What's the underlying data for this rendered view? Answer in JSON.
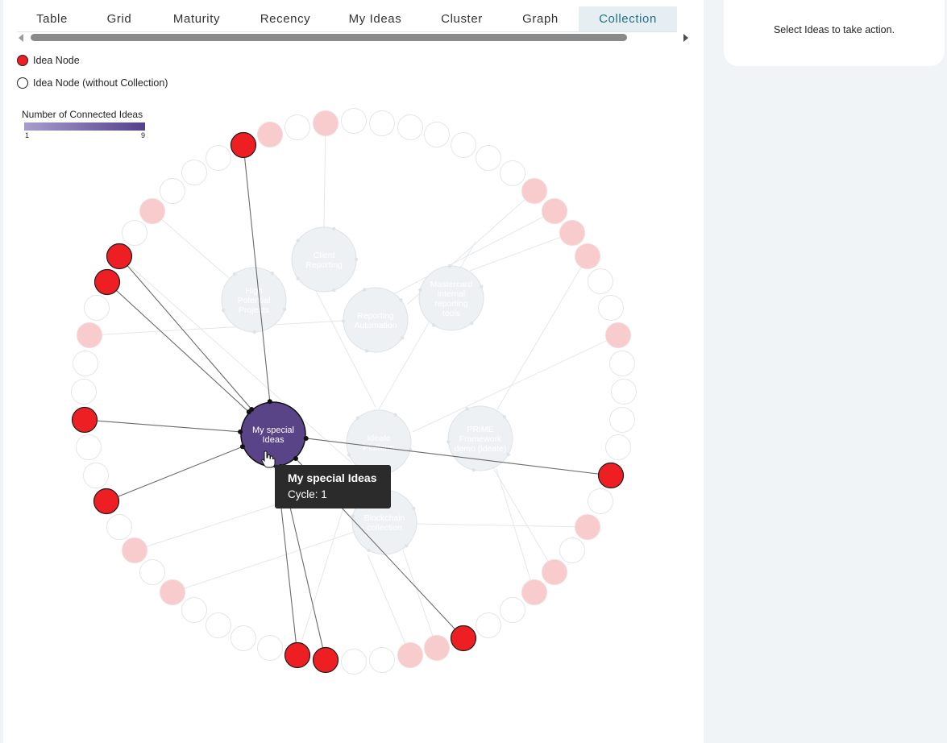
{
  "tabs": [
    {
      "label": "Table",
      "width": 87,
      "active": false
    },
    {
      "label": "Grid",
      "width": 80,
      "active": false
    },
    {
      "label": "Maturity",
      "width": 112,
      "active": false
    },
    {
      "label": "Recency",
      "width": 108,
      "active": false
    },
    {
      "label": "My Ideas",
      "width": 115,
      "active": false
    },
    {
      "label": "Cluster",
      "width": 100,
      "active": false
    },
    {
      "label": "Graph",
      "width": 95,
      "active": false
    },
    {
      "label": "Collection",
      "width": 122,
      "active": true
    }
  ],
  "legend": {
    "idea_node": "Idea Node",
    "idea_node_without_collection": "Idea Node (without Collection)",
    "gradient_title": "Number of Connected Ideas",
    "gradient_min": "1",
    "gradient_max": "9"
  },
  "colors": {
    "idea_node": "#ee1f23",
    "idea_node_faded": "#f8cbcd",
    "collection_active": "#594487",
    "collection_faded": "#eef1f4",
    "tab_active_text": "#1f6f8b"
  },
  "collections": [
    {
      "id": "client-reporting",
      "label": "Client Reporting",
      "lines": [
        "Client",
        "Reporting"
      ],
      "active": false
    },
    {
      "id": "high-potential",
      "label": "High Potential Projects",
      "lines": [
        "High",
        "Potential",
        "Projects"
      ],
      "active": false
    },
    {
      "id": "reporting-automation",
      "label": "Reporting Automation",
      "lines": [
        "Reporting",
        "Automation"
      ],
      "active": false
    },
    {
      "id": "mastercard-reporting",
      "label": "Mastercard internal reporting tools",
      "lines": [
        "Mastercard",
        "internal",
        "reporting",
        "tools"
      ],
      "active": false
    },
    {
      "id": "my-special-ideas",
      "label": "My special Ideas",
      "lines": [
        "My special",
        "Ideas"
      ],
      "active": true
    },
    {
      "id": "ideate-platform",
      "label": "Ideate Platform",
      "lines": [
        "Ideate",
        "Platform"
      ],
      "active": false
    },
    {
      "id": "prime-framework",
      "label": "PRIME Framework demo (ideate)",
      "lines": [
        "PRIME",
        "Framework",
        "demo (ideate)"
      ],
      "active": false
    },
    {
      "id": "blockchain",
      "label": "Blockchain collection",
      "lines": [
        "Blockchain",
        "collection"
      ],
      "active": false
    }
  ],
  "tooltip": {
    "title": "My special Ideas",
    "subtitle": "Cycle: 1"
  },
  "action_panel": {
    "text": "Select Ideas to take action."
  }
}
